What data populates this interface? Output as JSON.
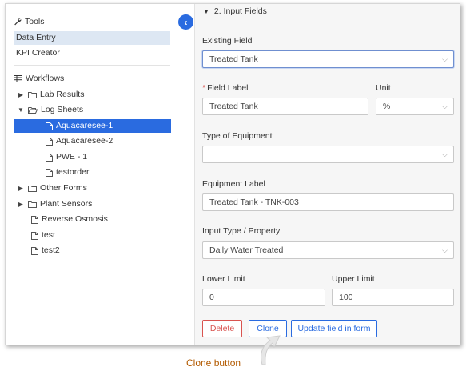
{
  "sidebar": {
    "tools_title": "Tools",
    "menu": [
      {
        "label": "Data Entry",
        "active": true
      },
      {
        "label": "KPI Creator",
        "active": false
      }
    ],
    "workflows_title": "Workflows",
    "tree": [
      {
        "label": "Lab Results",
        "type": "folder",
        "expanded": false
      },
      {
        "label": "Log Sheets",
        "type": "folder",
        "expanded": true
      },
      {
        "label": "Aquacaresee-1",
        "type": "file",
        "selected": true
      },
      {
        "label": "Aquacaresee-2",
        "type": "file"
      },
      {
        "label": "PWE - 1",
        "type": "file"
      },
      {
        "label": "testorder",
        "type": "file"
      },
      {
        "label": "Other Forms",
        "type": "folder",
        "expanded": false
      },
      {
        "label": "Plant Sensors",
        "type": "folder",
        "expanded": false
      },
      {
        "label": "Reverse Osmosis",
        "type": "file"
      },
      {
        "label": "test",
        "type": "file"
      },
      {
        "label": "test2",
        "type": "file"
      }
    ]
  },
  "panel": {
    "section_title": "2. Input Fields",
    "existing_field": {
      "label": "Existing Field",
      "value": "Treated Tank"
    },
    "field_label": {
      "label": "Field Label",
      "value": "Treated Tank"
    },
    "unit": {
      "label": "Unit",
      "value": "%"
    },
    "type_of_equipment": {
      "label": "Type of Equipment",
      "value": ""
    },
    "equipment_label": {
      "label": "Equipment Label",
      "value": "Treated Tank - TNK-003"
    },
    "input_type": {
      "label": "Input Type / Property",
      "value": "Daily Water Treated"
    },
    "lower_limit": {
      "label": "Lower Limit",
      "value": "0"
    },
    "upper_limit": {
      "label": "Upper Limit",
      "value": "100"
    },
    "buttons": {
      "delete": "Delete",
      "clone": "Clone",
      "update": "Update field in form"
    }
  },
  "annotation": "Clone button",
  "colors": {
    "accent": "#2a6be0",
    "danger": "#d9534f",
    "annotation": "#b25a00",
    "active_menu_bg": "#dde7f3"
  }
}
